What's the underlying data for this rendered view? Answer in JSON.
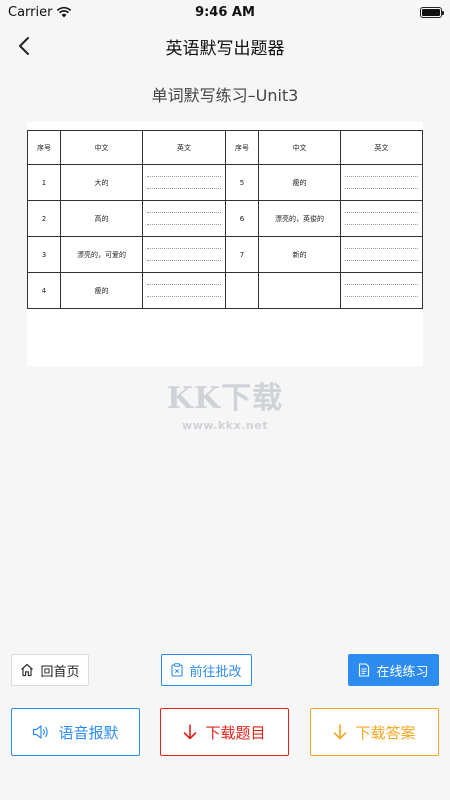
{
  "status_bar": {
    "carrier": "Carrier",
    "time": "9:46 AM",
    "wifi_icon": "wifi-icon",
    "battery_icon": "battery-icon",
    "battery_level": 1.0
  },
  "nav": {
    "back_icon": "chevron-left-icon",
    "title": "英语默写出题器"
  },
  "exercise": {
    "title": "单词默写练习–Unit3"
  },
  "worksheet": {
    "headers": [
      "序号",
      "中文",
      "英文",
      "序号",
      "中文",
      "英文"
    ],
    "rows": [
      {
        "left": {
          "num": "1",
          "zh": "大的"
        },
        "right": {
          "num": "5",
          "zh": "瘦的"
        }
      },
      {
        "left": {
          "num": "2",
          "zh": "高的"
        },
        "right": {
          "num": "6",
          "zh": "漂亮的，英俊的"
        }
      },
      {
        "left": {
          "num": "3",
          "zh": "漂亮的，可爱的"
        },
        "right": {
          "num": "7",
          "zh": "新的"
        }
      },
      {
        "left": {
          "num": "4",
          "zh": "瘦的"
        },
        "right": {
          "num": "",
          "zh": ""
        }
      }
    ]
  },
  "watermark": {
    "logo": "KK下载",
    "url": "www.kkx.net"
  },
  "actions": {
    "home": {
      "label": "回首页",
      "icon": "home-icon"
    },
    "review": {
      "label": "前往批改",
      "icon": "clipboard-icon"
    },
    "practice": {
      "label": "在线练习",
      "icon": "document-icon"
    },
    "speech": {
      "label": "语音报默",
      "icon": "speaker-icon"
    },
    "download_questions": {
      "label": "下载题目",
      "icon": "arrow-down-icon"
    },
    "download_answers": {
      "label": "下载答案",
      "icon": "arrow-down-icon"
    }
  },
  "colors": {
    "primary": "#2d8cf0",
    "danger": "#e2231a",
    "warning": "#f5a623",
    "background": "#f6f6f6"
  }
}
